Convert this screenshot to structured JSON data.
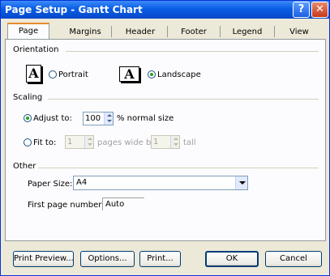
{
  "window": {
    "title": "Page Setup - Gantt Chart",
    "help_glyph": "?",
    "close_glyph": "✕"
  },
  "tabs": [
    "Page",
    "Margins",
    "Header",
    "Footer",
    "Legend",
    "View"
  ],
  "orientation": {
    "group_label": "Orientation",
    "portrait_label": "Portrait",
    "landscape_label": "Landscape",
    "selected": "Landscape",
    "icon_glyph": "A"
  },
  "scaling": {
    "group_label": "Scaling",
    "adjust_label": "Adjust to:",
    "adjust_value": "100",
    "adjust_suffix": "% normal size",
    "fit_label": "Fit to:",
    "fit_wide_value": "1",
    "fit_wide_suffix": "pages wide by",
    "fit_tall_value": "1",
    "fit_tall_suffix": "tall",
    "selected": "Adjust to"
  },
  "other": {
    "group_label": "Other",
    "paper_size_label": "Paper Size:",
    "paper_size_value": "A4",
    "first_page_label": "First page number:",
    "first_page_value": "Auto"
  },
  "buttons": {
    "print_preview": "Print Preview...",
    "options": "Options...",
    "print": "Print...",
    "ok": "OK",
    "cancel": "Cancel"
  }
}
